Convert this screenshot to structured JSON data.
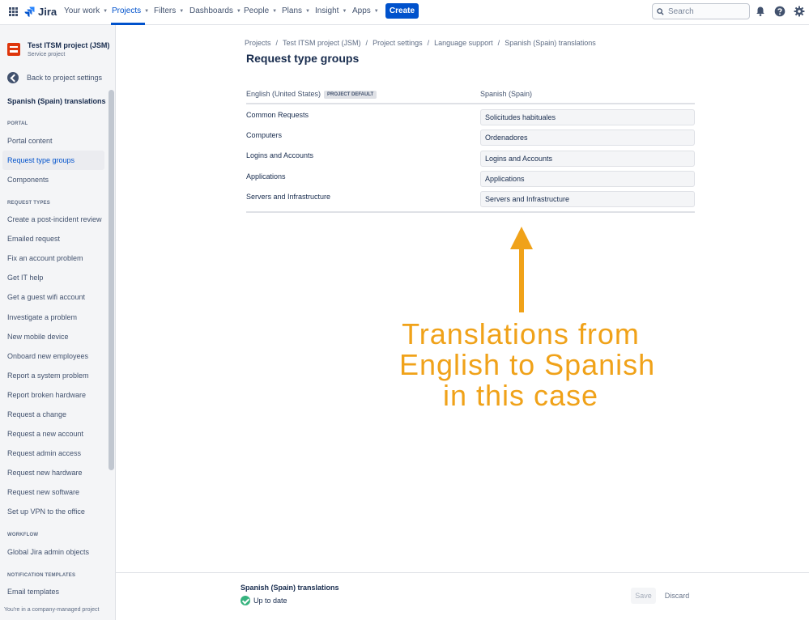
{
  "topnav": {
    "logo": "Jira",
    "items": [
      {
        "label": "Your work"
      },
      {
        "label": "Projects"
      },
      {
        "label": "Filters"
      },
      {
        "label": "Dashboards"
      },
      {
        "label": "People"
      },
      {
        "label": "Plans"
      },
      {
        "label": "Insight"
      },
      {
        "label": "Apps"
      }
    ],
    "active_item": "Projects",
    "create_label": "Create",
    "search_placeholder": "Search",
    "accent_color": "#0052cc",
    "icons": [
      "apps-grid-icon",
      "jira-logo-icon",
      "search-icon",
      "notification-bell-icon",
      "help-icon",
      "settings-gear-icon"
    ]
  },
  "sidebar": {
    "project_name": "Test ITSM project (JSM)",
    "project_type": "Service project",
    "back_label": "Back to project settings",
    "title": "Spanish (Spain) translations",
    "portal_heading": "PORTAL",
    "portal_items": [
      {
        "label": "Portal content"
      },
      {
        "label": "Request type groups"
      },
      {
        "label": "Components"
      }
    ],
    "active_item": "Request type groups",
    "request_types_heading": "REQUEST TYPES",
    "request_types": [
      {
        "label": "Create a post-incident review"
      },
      {
        "label": "Emailed request"
      },
      {
        "label": "Fix an account problem"
      },
      {
        "label": "Get IT help"
      },
      {
        "label": "Get a guest wifi account"
      },
      {
        "label": "Investigate a problem"
      },
      {
        "label": "New mobile device"
      },
      {
        "label": "Onboard new employees"
      },
      {
        "label": "Report a system problem"
      },
      {
        "label": "Report broken hardware"
      },
      {
        "label": "Request a change"
      },
      {
        "label": "Request a new account"
      },
      {
        "label": "Request admin access"
      },
      {
        "label": "Request new hardware"
      },
      {
        "label": "Request new software"
      },
      {
        "label": "Set up VPN to the office"
      }
    ],
    "workflow_heading": "WORKFLOW",
    "workflow_items": [
      {
        "label": "Global Jira admin objects"
      }
    ],
    "notification_heading": "NOTIFICATION TEMPLATES",
    "notification_items": [
      {
        "label": "Email templates"
      }
    ],
    "footer": "You're in a company-managed project"
  },
  "breadcrumb": [
    "Projects",
    "Test ITSM project (JSM)",
    "Project settings",
    "Language support",
    "Spanish (Spain) translations"
  ],
  "page_title": "Request type groups",
  "table": {
    "source_header": "English (United States)",
    "default_badge": "PROJECT DEFAULT",
    "target_header": "Spanish (Spain)",
    "rows": [
      {
        "source": "Common Requests",
        "translation": "Solicitudes habituales"
      },
      {
        "source": "Computers",
        "translation": "Ordenadores"
      },
      {
        "source": "Logins and Accounts",
        "translation": "Logins and Accounts"
      },
      {
        "source": "Applications",
        "translation": "Applications"
      },
      {
        "source": "Servers and Infrastructure",
        "translation": "Servers and Infrastructure"
      }
    ]
  },
  "annotation": {
    "lines": [
      "Translations from",
      "English to Spanish",
      "in this case"
    ],
    "color": "#f0a219"
  },
  "bottombar": {
    "title": "Spanish (Spain) translations",
    "status": "Up to date",
    "save_label": "Save",
    "discard_label": "Discard"
  }
}
